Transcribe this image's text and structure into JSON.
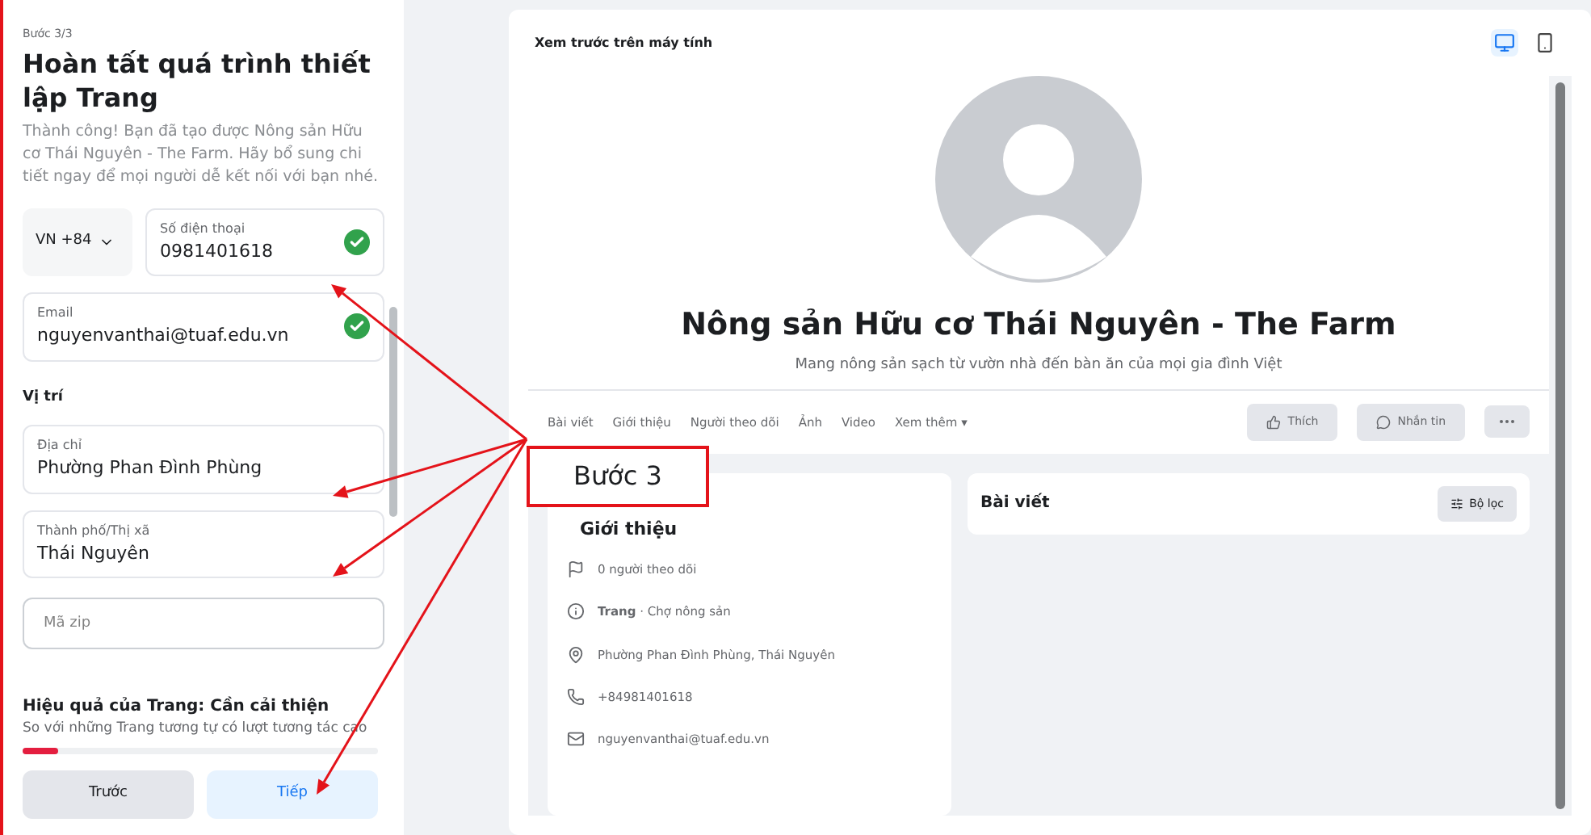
{
  "setup_panel": {
    "step": "Bước 3/3",
    "title": "Hoàn tất quá trình thiết lập Trang",
    "description": "Thành công! Bạn đã tạo được Nông sản Hữu cơ Thái Nguyên - The Farm. Hãy bổ sung chi tiết ngay để mọi người dễ kết nối với bạn nhé.",
    "country_code": "VN +84",
    "phone": {
      "label": "Số điện thoại",
      "value": "0981401618",
      "valid": true
    },
    "email": {
      "label": "Email",
      "value": "nguyenvanthai@tuaf.edu.vn",
      "valid": true
    },
    "location_heading": "Vị trí",
    "address": {
      "label": "Địa chỉ",
      "value": "Phường Phan Đình Phùng"
    },
    "city": {
      "label": "Thành phố/Thị xã",
      "value": "Thái Nguyên"
    },
    "zip": {
      "placeholder": "Mã zip"
    },
    "health": {
      "title": "Hiệu quả của Trang: Cần cải thiện",
      "description": "So với những Trang tương tự có lượt tương tác cao",
      "level": 0.1
    },
    "buttons": [
      {
        "label": "Trước",
        "kind": "secondary"
      },
      {
        "label": "Tiếp",
        "kind": "primary"
      }
    ]
  },
  "preview": {
    "title": "Xem trước trên máy tính",
    "devices": [
      {
        "kind": "desktop",
        "selected": true
      },
      {
        "kind": "mobile",
        "selected": false
      }
    ],
    "page_name": "Nông sản Hữu cơ Thái Nguyên - The Farm",
    "tagline": "Mang nông sản sạch từ vườn nhà đến bàn ăn của mọi gia đình Việt",
    "tabs": [
      {
        "label": "Bài viết"
      },
      {
        "label": "Giới thiệu"
      },
      {
        "label": "Người theo dõi"
      },
      {
        "label": "Ảnh"
      },
      {
        "label": "Video"
      },
      {
        "label": "Xem thêm ▾"
      }
    ],
    "actions": [
      "Thích",
      "Nhắn tin"
    ],
    "intro": {
      "title": "Giới thiệu",
      "items": [
        {
          "kind": "followers",
          "text": "0 người theo dõi"
        },
        {
          "kind": "category",
          "text": "**Trang** · Chợ nông sản"
        },
        {
          "kind": "address",
          "text": "Phường Phan Đình Phùng, Thái Nguyên"
        },
        {
          "kind": "phone",
          "text": "+84981401618"
        },
        {
          "kind": "email",
          "text": "nguyenvanthai@tuaf.edu.vn"
        }
      ]
    },
    "posts": {
      "title": "Bài viết",
      "filter": "Bộ lọc"
    }
  },
  "callout": {
    "label": "Bước 3"
  }
}
